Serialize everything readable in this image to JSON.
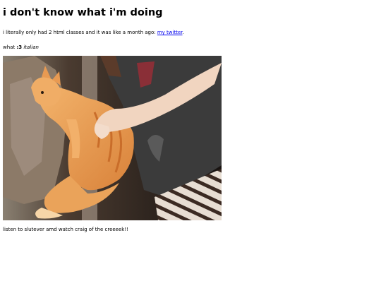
{
  "heading": "i don't know what i'm doing",
  "intro": {
    "text": "i literally only had 2 html classes and it was like a month ago: ",
    "link_label": "my twitter",
    "trailing": "."
  },
  "what_line": {
    "prefix": "what ",
    "bold": ":3",
    "italic": "italian"
  },
  "image_caption": "cat ginger.png",
  "image": {
    "alt": "ginger cat held by a person in a dark t-shirt and zebra-print pants",
    "colors": {
      "cat": "#e69a4c",
      "shirt": "#3a3a3a",
      "background": "#1c1613"
    }
  },
  "footer": "listen to slutever amd watch craig of the creeeek!!"
}
